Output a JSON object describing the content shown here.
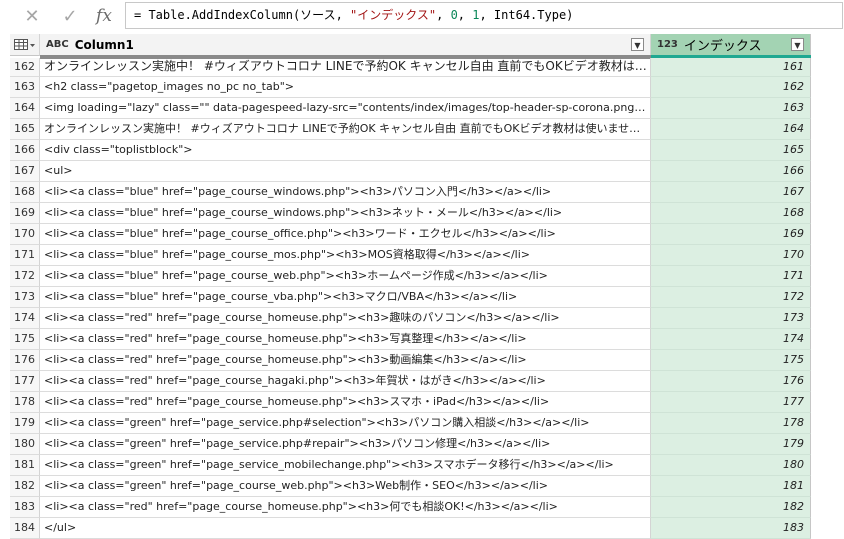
{
  "formula": {
    "cancel_icon": "✕",
    "commit_icon": "✓",
    "fx_label": "fx",
    "prefix": "= Table.AddIndexColumn(ソース, ",
    "arg_name": "\"インデックス\"",
    "sep1": ", ",
    "arg_start": "0",
    "sep2": ", ",
    "arg_step": "1",
    "suffix": ", Int64.Type)"
  },
  "columns": {
    "col1": {
      "type_icon": "ABC",
      "label": "Column1"
    },
    "index": {
      "type_icon": "123",
      "label": "インデックス"
    }
  },
  "rows": [
    {
      "n": "162",
      "v": "オンラインレッスン実施中！ #ウィズアウトコロナ LINEで予約OK キャンセル自由  直前でもOKビデオ教材は使いません...",
      "i": "161"
    },
    {
      "n": "163",
      "v": "<h2 class=\"pagetop_images no_pc no_tab\">",
      "i": "162"
    },
    {
      "n": "164",
      "v": "<img loading=\"lazy\" class=\"\" data-pagespeed-lazy-src=\"contents/index/images/top-header-sp-corona.png\" alt=\"パソコン...",
      "i": "163"
    },
    {
      "n": "165",
      "v": "オンラインレッスン実施中！ #ウィズアウトコロナ LINEで予約OK キャンセル自由  直前でもOKビデオ教材は使いません...",
      "i": "164"
    },
    {
      "n": "166",
      "v": "<div class=\"toplistblock\">",
      "i": "165"
    },
    {
      "n": "167",
      "v": "<ul>",
      "i": "166"
    },
    {
      "n": "168",
      "v": "<li><a class=\"blue\" href=\"page_course_windows.php\"><h3>パソコン入門</h3></a></li>",
      "i": "167"
    },
    {
      "n": "169",
      "v": "<li><a class=\"blue\" href=\"page_course_windows.php\"><h3>ネット・メール</h3></a></li>",
      "i": "168"
    },
    {
      "n": "170",
      "v": "<li><a class=\"blue\" href=\"page_course_office.php\"><h3>ワード・エクセル</h3></a></li>",
      "i": "169"
    },
    {
      "n": "171",
      "v": "<li><a class=\"blue\" href=\"page_course_mos.php\"><h3>MOS資格取得</h3></a></li>",
      "i": "170"
    },
    {
      "n": "172",
      "v": "<li><a class=\"blue\" href=\"page_course_web.php\"><h3>ホームページ作成</h3></a></li>",
      "i": "171"
    },
    {
      "n": "173",
      "v": "<li><a class=\"blue\" href=\"page_course_vba.php\"><h3>マクロ/VBA</h3></a></li>",
      "i": "172"
    },
    {
      "n": "174",
      "v": "<li><a class=\"red\" href=\"page_course_homeuse.php\"><h3>趣味のパソコン</h3></a></li>",
      "i": "173"
    },
    {
      "n": "175",
      "v": "<li><a class=\"red\" href=\"page_course_homeuse.php\"><h3>写真整理</h3></a></li>",
      "i": "174"
    },
    {
      "n": "176",
      "v": "<li><a class=\"red\" href=\"page_course_homeuse.php\"><h3>動画編集</h3></a></li>",
      "i": "175"
    },
    {
      "n": "177",
      "v": "<li><a class=\"red\" href=\"page_course_hagaki.php\"><h3>年賀状・はがき</h3></a></li>",
      "i": "176"
    },
    {
      "n": "178",
      "v": "<li><a class=\"red\" href=\"page_course_homeuse.php\"><h3>スマホ・iPad</h3></a></li>",
      "i": "177"
    },
    {
      "n": "179",
      "v": "<li><a class=\"green\" href=\"page_service.php#selection\"><h3>パソコン購入相談</h3></a></li>",
      "i": "178"
    },
    {
      "n": "180",
      "v": "<li><a class=\"green\" href=\"page_service.php#repair\"><h3>パソコン修理</h3></a></li>",
      "i": "179"
    },
    {
      "n": "181",
      "v": "<li><a class=\"green\" href=\"page_service_mobilechange.php\"><h3>スマホデータ移行</h3></a></li>",
      "i": "180"
    },
    {
      "n": "182",
      "v": "<li><a class=\"green\" href=\"page_course_web.php\"><h3>Web制作・SEO</h3></a></li>",
      "i": "181"
    },
    {
      "n": "183",
      "v": "<li><a class=\"red\" href=\"page_course_homeuse.php\"><h3>何でも相談OK!</h3></a></li>",
      "i": "182"
    },
    {
      "n": "184",
      "v": "</ul>",
      "i": "183"
    }
  ]
}
